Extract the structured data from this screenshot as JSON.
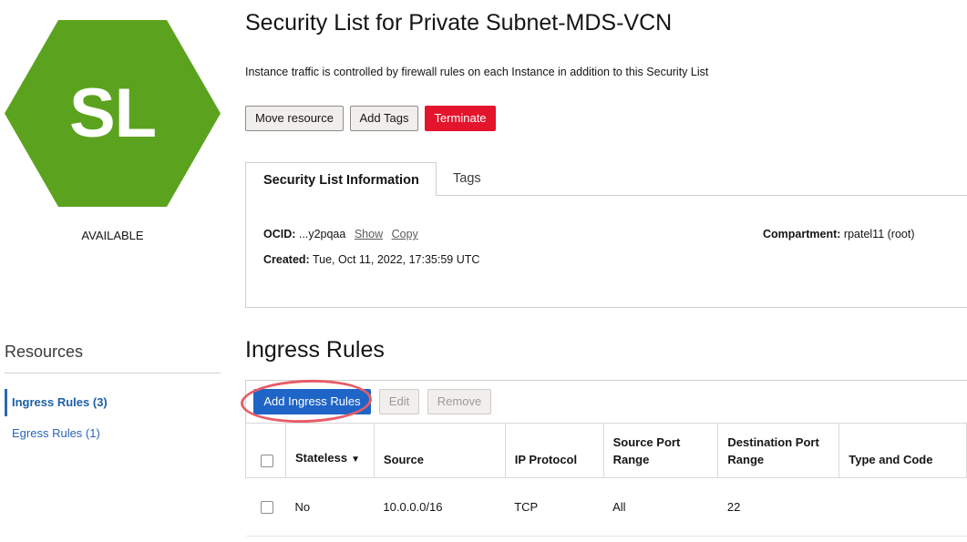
{
  "resource_icon": {
    "initials": "SL",
    "color": "#5ba31e"
  },
  "state": "AVAILABLE",
  "page_title": "Security List for Private Subnet-MDS-VCN",
  "subtitle": "Instance traffic is controlled by firewall rules on each Instance in addition to this Security List",
  "actions": {
    "move": "Move resource",
    "tags": "Add Tags",
    "terminate": "Terminate"
  },
  "tabs": [
    {
      "label": "Security List Information",
      "active": true
    },
    {
      "label": "Tags",
      "active": false
    }
  ],
  "info": {
    "ocid_label": "OCID:",
    "ocid_value": "...y2pqaa",
    "show": "Show",
    "copy": "Copy",
    "created_label": "Created:",
    "created_value": "Tue, Oct 11, 2022, 17:35:59 UTC",
    "compartment_label": "Compartment:",
    "compartment_value": "rpatel11 (root)"
  },
  "resources": {
    "title": "Resources",
    "items": [
      {
        "label": "Ingress Rules (3)",
        "active": true
      },
      {
        "label": "Egress Rules (1)",
        "active": false
      }
    ]
  },
  "ingress": {
    "title": "Ingress Rules",
    "add": "Add Ingress Rules",
    "edit": "Edit",
    "remove": "Remove",
    "columns": [
      "Stateless",
      "Source",
      "IP Protocol",
      "Source Port Range",
      "Destination Port Range",
      "Type and Code"
    ],
    "rows": [
      {
        "stateless": "No",
        "source": "10.0.0.0/16",
        "protocol": "TCP",
        "source_port": "All",
        "dest_port": "22",
        "type_code": ""
      }
    ]
  },
  "colors": {
    "accent": "#1f65c8",
    "danger": "#e3152c",
    "annotation": "#e85c66"
  }
}
